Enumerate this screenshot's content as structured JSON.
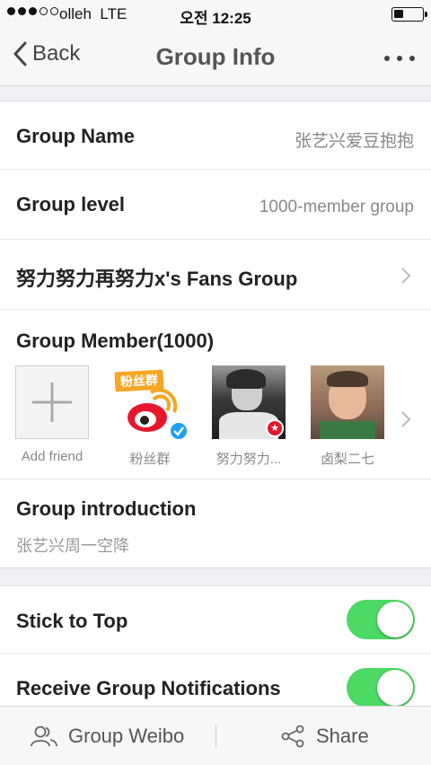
{
  "status_bar": {
    "carrier": "olleh",
    "network": "LTE",
    "time": "오전 12:25",
    "signal_bars_filled": 3,
    "signal_bars_total": 5,
    "battery_level": 0.35
  },
  "nav": {
    "back_label": "Back",
    "title": "Group Info",
    "more_icon": "ellipsis-icon"
  },
  "info": {
    "group_name_label": "Group Name",
    "group_name_value": "张艺兴爱豆抱抱",
    "group_level_label": "Group level",
    "group_level_value": "1000-member group",
    "fans_group_label": "努力努力再努力x's Fans Group"
  },
  "members": {
    "title": "Group Member(1000)",
    "add_label": "Add friend",
    "items": [
      {
        "name": "粉丝群",
        "badge_text": "粉丝群"
      },
      {
        "name": "努力努力..."
      },
      {
        "name": "卤梨二七"
      }
    ]
  },
  "intro": {
    "label": "Group introduction",
    "value": "张艺兴周一空降"
  },
  "settings": {
    "stick_to_top_label": "Stick to Top",
    "stick_to_top_on": true,
    "notifications_label": "Receive Group Notifications",
    "notifications_on": true
  },
  "bottom_bar": {
    "weibo_label": "Group Weibo",
    "share_label": "Share"
  },
  "colors": {
    "toggle_on": "#4cd964",
    "weibo_red": "#e6162d",
    "weibo_orange": "#f5a623",
    "verified_blue": "#1da1f2"
  }
}
